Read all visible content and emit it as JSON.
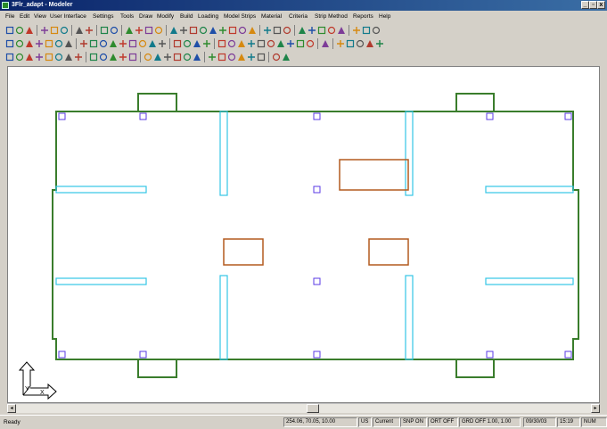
{
  "window": {
    "title": "3Flr_adapt - Modeler",
    "min_glyph": "_",
    "restore_glyph": "▫",
    "close_glyph": "x"
  },
  "menu": [
    "File",
    "Edit",
    "View",
    "User Interface",
    "Settings",
    "Tools",
    "Draw",
    "Modify",
    "Build",
    "Loading",
    "Model Strips",
    "Material",
    "Criteria",
    "Strip Method",
    "Reports",
    "Help"
  ],
  "toolbar_icons": {
    "row1": [
      "new-icon",
      "open-icon",
      "save-icon",
      "|",
      "cut-icon",
      "copy-icon",
      "paste-icon",
      "|",
      "undo-icon",
      "redo-icon",
      "|",
      "print-icon",
      "help-icon",
      "|",
      "layers-icon",
      "list-icon",
      "grid-icon",
      "pointer-icon",
      "|",
      "view-top-icon",
      "view-front-icon",
      "view-side-icon",
      "view-iso-icon",
      "view-3d-icon",
      "view-render-icon",
      "snap-icon",
      "snap-mid-icon",
      "snap-end-icon",
      "|",
      "text-icon",
      "dim-icon",
      "table-icon",
      "|",
      "beam-icon",
      "column-icon",
      "wall-icon",
      "slab-icon",
      "opening-icon",
      "|",
      "mesh-icon",
      "analyze-icon",
      "results-icon"
    ],
    "row2": [
      "select-icon",
      "node-icon",
      "point-icon",
      "move-icon",
      "rotate-icon",
      "copy-move-icon",
      "mirror-icon",
      "|",
      "zoom-in-icon",
      "zoom-out-icon",
      "zoom-window-icon",
      "zoom-all-icon",
      "pan-icon",
      "redraw-icon",
      "zoom-prev-icon",
      "rect-icon",
      "frame-icon",
      "|",
      "tendon-icon",
      "rebar-icon",
      "support-icon",
      "load-icon",
      "|",
      "line-icon",
      "polyline-icon",
      "circle-icon",
      "cross-icon",
      "ortho-icon",
      "plus-icon",
      "hatch-icon",
      "grid2-icon",
      "layer-icon",
      "settings-icon",
      "|",
      "arc-icon",
      "|",
      "plus2-icon",
      "slash-icon",
      "curve-icon",
      "triangle-icon",
      "circle2-icon"
    ],
    "row3": [
      "tool-a-icon",
      "tool-b-icon",
      "tool-c-icon",
      "tool-d-icon",
      "tool-e-icon",
      "tool-f-icon",
      "tool-g-icon",
      "tool-h-icon",
      "|",
      "tool-i-icon",
      "tool-j-icon",
      "tool-k-icon",
      "tool-l-icon",
      "tool-m-icon",
      "|",
      "tool-n-icon",
      "tool-o-icon",
      "tool-p-icon",
      "tool-q-icon",
      "tool-r-icon",
      "tool-s-icon",
      "|",
      "tool-t-icon",
      "tool-u-icon",
      "tool-v-icon",
      "tool-w-icon",
      "tool-x-icon",
      "tool-y-icon",
      "|",
      "tool-z-icon",
      "tool-aa-icon"
    ]
  },
  "colors": {
    "slab": "#3a7d2c",
    "drop_panel": "#b35a1f",
    "wall": "#34c6e6",
    "column": "#5a3ae6"
  },
  "statusbar": {
    "ready": "Ready",
    "coords": "254.06, 70.05, 10.00",
    "units": "US",
    "current": "Current",
    "snap": "SNP ON",
    "ortho": "ORT OFF",
    "grid": "GRD OFF 1.00, 1.00",
    "date": "09/30/03",
    "time": "15:19",
    "num": "NUM"
  }
}
